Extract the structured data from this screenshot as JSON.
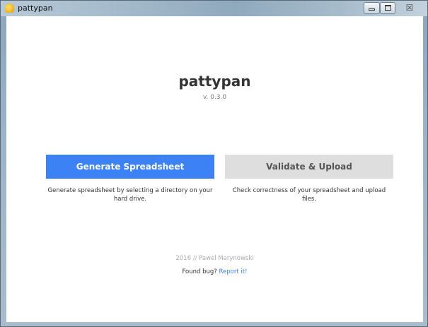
{
  "window": {
    "title": "pattypan",
    "icon": "app-logo-icon",
    "controls": {
      "minimize_icon": "minimize-icon",
      "maximize_icon": "maximize-icon",
      "close_icon": "close-icon",
      "close_glyph": "☒"
    }
  },
  "app": {
    "name": "pattypan",
    "version": "v. 0.3.0"
  },
  "actions": {
    "generate": {
      "label": "Generate Spreadsheet",
      "description": "Generate spreadsheet by selecting a directory on your hard drive."
    },
    "validate": {
      "label": "Validate & Upload",
      "description": "Check correctness of your spreadsheet and upload files."
    }
  },
  "footer": {
    "credit": "2016 // Pawel Marynowski",
    "bug_text": "Found bug?",
    "bug_link": "Report it!"
  },
  "colors": {
    "primary": "#3d82f5",
    "secondary_button": "#dedede",
    "muted_text": "#aaaaaa"
  }
}
